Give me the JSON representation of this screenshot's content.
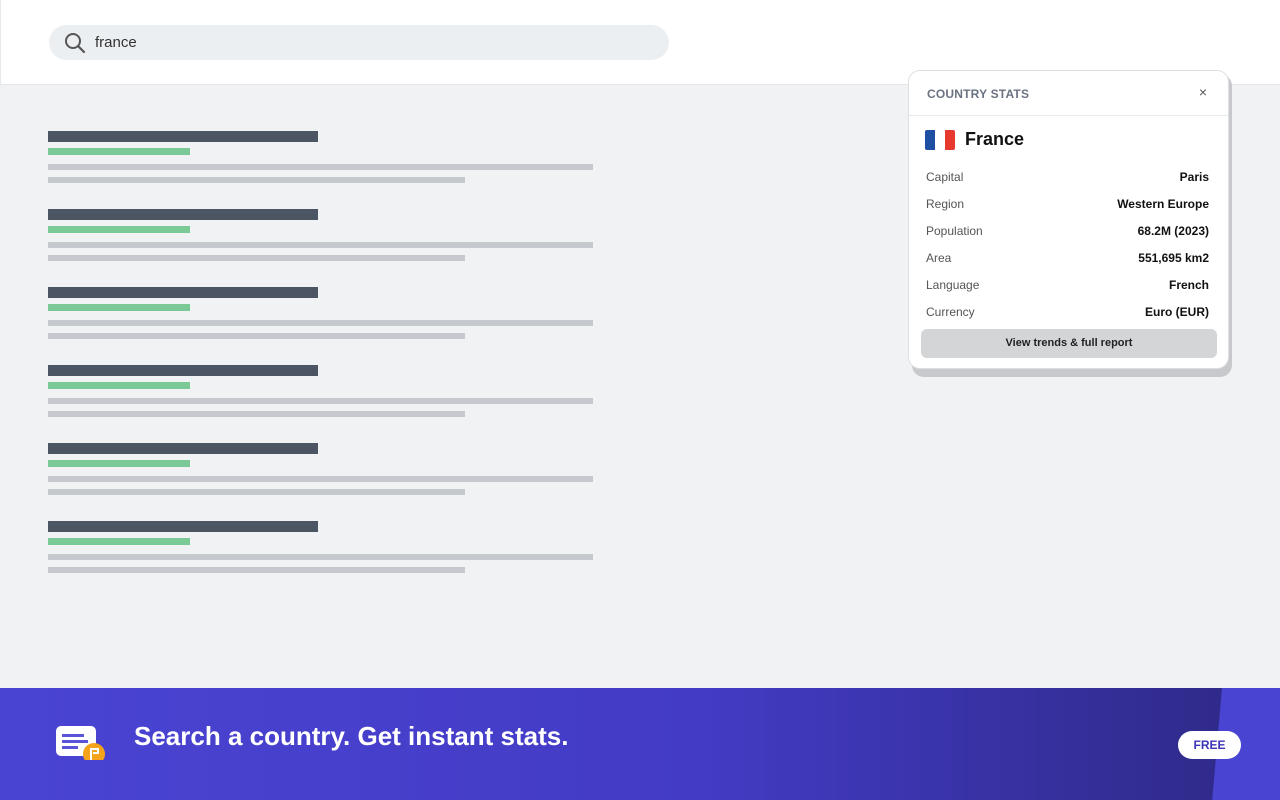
{
  "search": {
    "value": "france",
    "icon": "search-icon"
  },
  "results_count": 6,
  "card": {
    "title": "COUNTRY STATS",
    "close_label": "×",
    "country": "France",
    "flag_colors": [
      "#1f4fa3",
      "#ffffff",
      "#e8392f"
    ],
    "stats": [
      {
        "label": "Capital",
        "value": "Paris"
      },
      {
        "label": "Region",
        "value": "Western Europe"
      },
      {
        "label": "Population",
        "value": "68.2M (2023)"
      },
      {
        "label": "Area",
        "value": "551,695 km2"
      },
      {
        "label": "Language",
        "value": "French"
      },
      {
        "label": "Currency",
        "value": "Euro (EUR)"
      }
    ],
    "button_label": "View trends & full report"
  },
  "banner": {
    "headline": "Search a country. Get instant stats.",
    "badge": "FREE",
    "accent": "#4a44d3"
  }
}
